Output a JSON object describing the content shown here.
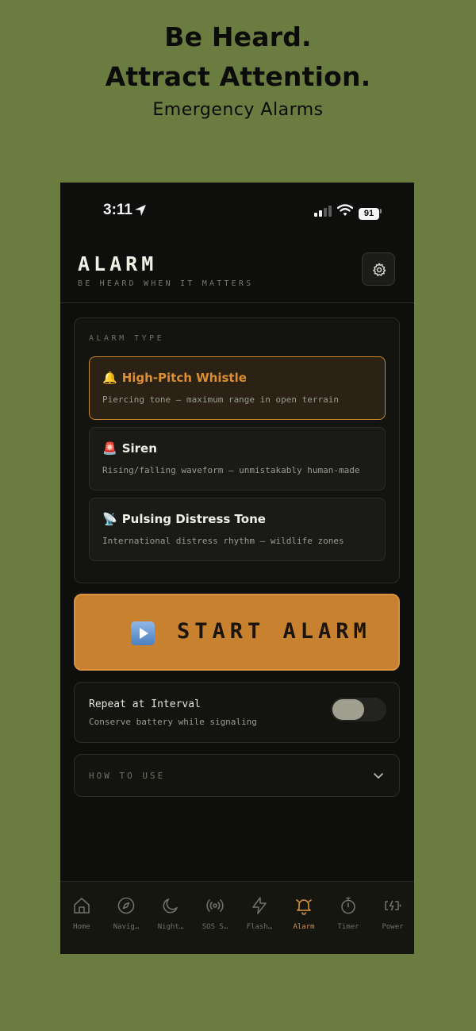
{
  "promo": {
    "line1": "Be Heard.",
    "line2": "Attract Attention.",
    "subtitle": "Emergency Alarms"
  },
  "status_bar": {
    "time": "3:11",
    "battery": "91"
  },
  "header": {
    "title": "ALARM",
    "tagline": "BE HEARD WHEN IT MATTERS"
  },
  "alarm_type": {
    "label": "ALARM TYPE",
    "options": [
      {
        "emoji": "🔔",
        "title": "High-Pitch Whistle",
        "desc": "Piercing tone — maximum range in open terrain",
        "selected": true
      },
      {
        "emoji": "🚨",
        "title": "Siren",
        "desc": "Rising/falling waveform — unmistakably human-made",
        "selected": false
      },
      {
        "emoji": "📡",
        "title": "Pulsing Distress Tone",
        "desc": "International distress rhythm — wildlife zones",
        "selected": false
      }
    ]
  },
  "start_button": {
    "label": "START ALARM"
  },
  "repeat": {
    "title": "Repeat at Interval",
    "desc": "Conserve battery while signaling",
    "enabled": false
  },
  "how_to": {
    "label": "HOW TO USE"
  },
  "tabs": [
    {
      "label": "Home",
      "icon": "home-icon"
    },
    {
      "label": "Navig…",
      "icon": "compass-icon"
    },
    {
      "label": "Night…",
      "icon": "moon-icon"
    },
    {
      "label": "SOS S…",
      "icon": "broadcast-icon"
    },
    {
      "label": "Flash…",
      "icon": "flash-icon"
    },
    {
      "label": "Alarm",
      "icon": "bell-icon",
      "active": true
    },
    {
      "label": "Timer",
      "icon": "timer-icon"
    },
    {
      "label": "Power",
      "icon": "battery-charging-icon"
    }
  ],
  "colors": {
    "background": "#6b7c41",
    "accent": "#c8812e",
    "phone_bg": "#0e0f0c"
  }
}
